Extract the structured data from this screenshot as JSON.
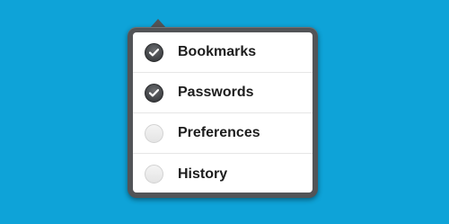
{
  "menu": {
    "items": [
      {
        "label": "Bookmarks",
        "checked": true
      },
      {
        "label": "Passwords",
        "checked": true
      },
      {
        "label": "Preferences",
        "checked": false
      },
      {
        "label": "History",
        "checked": false
      }
    ]
  },
  "colors": {
    "background": "#0ea3d8",
    "popover_frame": "#525457",
    "checked_fill": "#3f4144",
    "check_mark": "#ffffff",
    "text": "#1d1d1d"
  },
  "icons": {
    "checked": "checkmark-icon",
    "unchecked": "empty-circle-icon"
  }
}
